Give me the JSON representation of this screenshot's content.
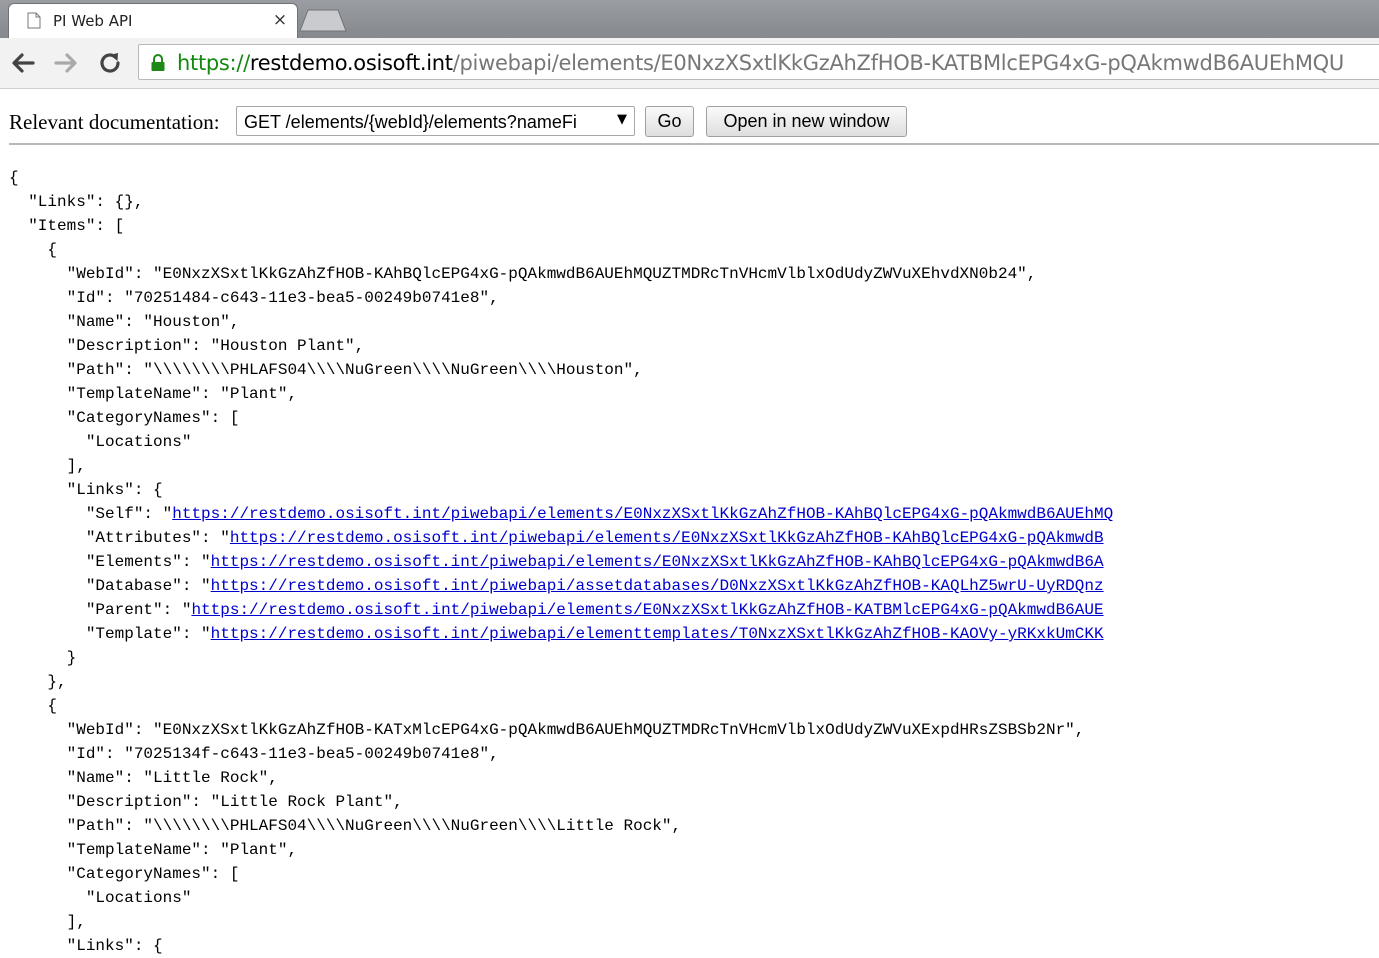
{
  "tab": {
    "title": "PI Web API",
    "close_label": "×",
    "icon": "document-icon"
  },
  "toolbar": {
    "back_icon": "back-arrow-icon",
    "forward_icon": "forward-arrow-icon",
    "reload_icon": "reload-icon",
    "url": {
      "scheme": "https://",
      "host": "restdemo.osisoft.int",
      "path": "/piwebapi/elements/E0NxzXSxtlKkGzAhZfHOB-KATBMlcEPG4xG-pQAkmwdB6AUEhMQU"
    }
  },
  "docbar": {
    "label": "Relevant documentation:",
    "selected": "GET /elements/{webId}/elements?nameFi",
    "go_label": "Go",
    "open_label": "Open in new window"
  },
  "json_lines": [
    {
      "text": "{"
    },
    {
      "text": "  \"Links\": {},"
    },
    {
      "text": "  \"Items\": ["
    },
    {
      "text": "    {"
    },
    {
      "text": "      \"WebId\": \"E0NxzXSxtlKkGzAhZfHOB-KAhBQlcEPG4xG-pQAkmwdB6AUEhMQUZTMDRcTnVHcmVlblxOdUdyZWVuXEhvdXN0b24\","
    },
    {
      "text": "      \"Id\": \"70251484-c643-11e3-bea5-00249b0741e8\","
    },
    {
      "text": "      \"Name\": \"Houston\","
    },
    {
      "text": "      \"Description\": \"Houston Plant\","
    },
    {
      "text": "      \"Path\": \"\\\\\\\\\\\\\\\\PHLAFS04\\\\\\\\NuGreen\\\\\\\\NuGreen\\\\\\\\Houston\","
    },
    {
      "text": "      \"TemplateName\": \"Plant\","
    },
    {
      "text": "      \"CategoryNames\": ["
    },
    {
      "text": "        \"Locations\""
    },
    {
      "text": "      ],"
    },
    {
      "text": "      \"Links\": {"
    },
    {
      "prefix": "        \"Self\": \"",
      "link": "https://restdemo.osisoft.int/piwebapi/elements/E0NxzXSxtlKkGzAhZfHOB-KAhBQlcEPG4xG-pQAkmwdB6AUEhMQ"
    },
    {
      "prefix": "        \"Attributes\": \"",
      "link": "https://restdemo.osisoft.int/piwebapi/elements/E0NxzXSxtlKkGzAhZfHOB-KAhBQlcEPG4xG-pQAkmwdB"
    },
    {
      "prefix": "        \"Elements\": \"",
      "link": "https://restdemo.osisoft.int/piwebapi/elements/E0NxzXSxtlKkGzAhZfHOB-KAhBQlcEPG4xG-pQAkmwdB6A"
    },
    {
      "prefix": "        \"Database\": \"",
      "link": "https://restdemo.osisoft.int/piwebapi/assetdatabases/D0NxzXSxtlKkGzAhZfHOB-KAQLhZ5wrU-UyRDQnz"
    },
    {
      "prefix": "        \"Parent\": \"",
      "link": "https://restdemo.osisoft.int/piwebapi/elements/E0NxzXSxtlKkGzAhZfHOB-KATBMlcEPG4xG-pQAkmwdB6AUE"
    },
    {
      "prefix": "        \"Template\": \"",
      "link": "https://restdemo.osisoft.int/piwebapi/elementtemplates/T0NxzXSxtlKkGzAhZfHOB-KAOVy-yRKxkUmCKK"
    },
    {
      "text": "      }"
    },
    {
      "text": "    },"
    },
    {
      "text": "    {"
    },
    {
      "text": "      \"WebId\": \"E0NxzXSxtlKkGzAhZfHOB-KATxMlcEPG4xG-pQAkmwdB6AUEhMQUZTMDRcTnVHcmVlblxOdUdyZWVuXExpdHRsZSBSb2Nr\","
    },
    {
      "text": "      \"Id\": \"7025134f-c643-11e3-bea5-00249b0741e8\","
    },
    {
      "text": "      \"Name\": \"Little Rock\","
    },
    {
      "text": "      \"Description\": \"Little Rock Plant\","
    },
    {
      "text": "      \"Path\": \"\\\\\\\\\\\\\\\\PHLAFS04\\\\\\\\NuGreen\\\\\\\\NuGreen\\\\\\\\Little Rock\","
    },
    {
      "text": "      \"TemplateName\": \"Plant\","
    },
    {
      "text": "      \"CategoryNames\": ["
    },
    {
      "text": "        \"Locations\""
    },
    {
      "text": "      ],"
    },
    {
      "text": "      \"Links\": {"
    }
  ]
}
